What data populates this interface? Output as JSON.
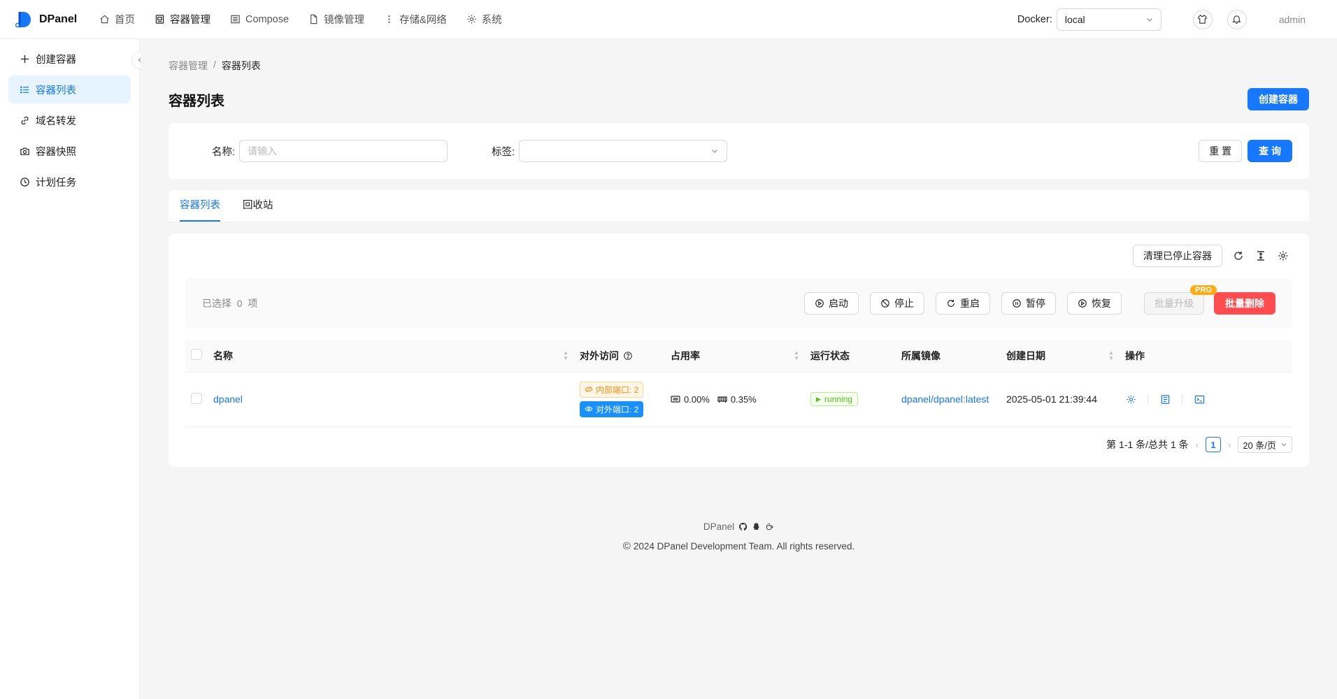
{
  "app": {
    "name": "DPanel"
  },
  "topnav": [
    {
      "label": "首页",
      "icon": "home-icon"
    },
    {
      "label": "容器管理",
      "icon": "container-icon",
      "active": true
    },
    {
      "label": "Compose",
      "icon": "compose-icon"
    },
    {
      "label": "镜像管理",
      "icon": "file-icon"
    },
    {
      "label": "存储&网络",
      "icon": "dots-icon"
    },
    {
      "label": "系统",
      "icon": "gear-icon"
    }
  ],
  "docker": {
    "label": "Docker:",
    "value": "local"
  },
  "user": {
    "name": "admin"
  },
  "sidebar": [
    {
      "label": "创建容器",
      "icon": "plus-icon"
    },
    {
      "label": "容器列表",
      "icon": "list-icon",
      "active": true
    },
    {
      "label": "域名转发",
      "icon": "link-icon"
    },
    {
      "label": "容器快照",
      "icon": "camera-icon"
    },
    {
      "label": "计划任务",
      "icon": "clock-icon"
    }
  ],
  "breadcrumb": {
    "parent": "容器管理",
    "separator": "/",
    "current": "容器列表"
  },
  "page": {
    "title": "容器列表",
    "create_button": "创建容器"
  },
  "filter": {
    "name_label": "名称:",
    "name_placeholder": "请输入",
    "tag_label": "标签:",
    "reset_button": "重 置",
    "search_button": "查 询"
  },
  "tabs": [
    {
      "label": "容器列表",
      "active": true
    },
    {
      "label": "回收站"
    }
  ],
  "toolbar": {
    "clean_button": "清理已停止容器"
  },
  "batch": {
    "selected_prefix": "已选择",
    "selected_count": "0",
    "selected_suffix": "项",
    "start": "启动",
    "stop": "停止",
    "restart": "重启",
    "pause": "暂停",
    "resume": "恢复",
    "upgrade": "批量升级",
    "pro_badge": "PRO",
    "delete": "批量删除"
  },
  "table": {
    "columns": {
      "name": "名称",
      "access": "对外访问",
      "usage": "占用率",
      "status": "运行状态",
      "image": "所属镜像",
      "created": "创建日期",
      "ops": "操作"
    },
    "rows": [
      {
        "name": "dpanel",
        "internal_port": "内部端口: 2",
        "external_port": "对外端口: 2",
        "cpu": "0.00%",
        "mem": "0.35%",
        "status": "running",
        "image": "dpanel/dpanel:latest",
        "created": "2025-05-01 21:39:44"
      }
    ]
  },
  "pagination": {
    "summary": "第 1-1 条/总共 1 条",
    "current": "1",
    "page_size": "20 条/页"
  },
  "footer": {
    "brand": "DPanel",
    "copyright": "2024 DPanel Development Team. All rights reserved."
  },
  "colors": {
    "primary": "#1677ff",
    "danger": "#ff4d4f",
    "success": "#52c41a",
    "warning": "#faad14"
  }
}
